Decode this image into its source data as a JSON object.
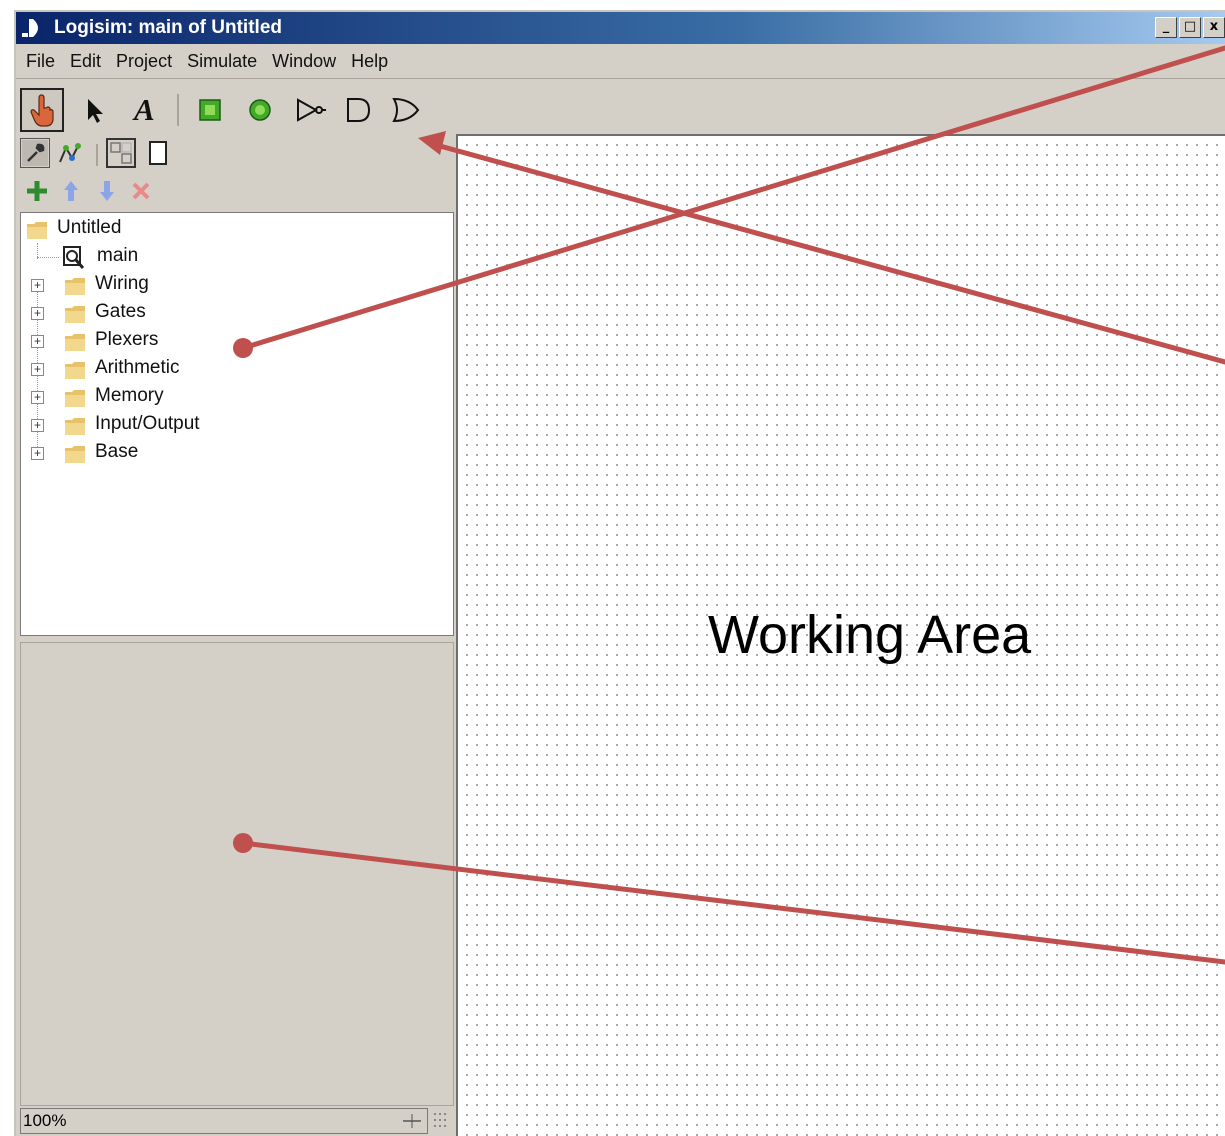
{
  "window": {
    "title": "Logisim: main of Untitled",
    "controls": {
      "minimize": "_",
      "maximize": "□",
      "close": "x"
    }
  },
  "menu": [
    "File",
    "Edit",
    "Project",
    "Simulate",
    "Window",
    "Help"
  ],
  "toolbar": {
    "tools": [
      {
        "icon": "poke-hand-icon",
        "selected": true
      },
      {
        "icon": "select-arrow-icon",
        "selected": false
      },
      {
        "icon": "text-tool-icon",
        "selected": false
      },
      {
        "icon": "input-pin-icon",
        "selected": false
      },
      {
        "icon": "output-pin-icon",
        "selected": false
      },
      {
        "icon": "not-gate-icon",
        "selected": false
      },
      {
        "icon": "and-gate-icon",
        "selected": false
      },
      {
        "icon": "or-gate-icon",
        "selected": false
      }
    ],
    "text_tool_glyph": "A"
  },
  "explorer": {
    "root": "Untitled",
    "circuit": "main",
    "libraries": [
      "Wiring",
      "Gates",
      "Plexers",
      "Arithmetic",
      "Memory",
      "Input/Output",
      "Base"
    ]
  },
  "zoom": "100%",
  "canvas": {
    "annotation": "Working Area"
  },
  "colors": {
    "arrow": "#c0504d",
    "titlebar": "#0a246a",
    "add": "#2e8b2e",
    "remove": "#e05050"
  }
}
